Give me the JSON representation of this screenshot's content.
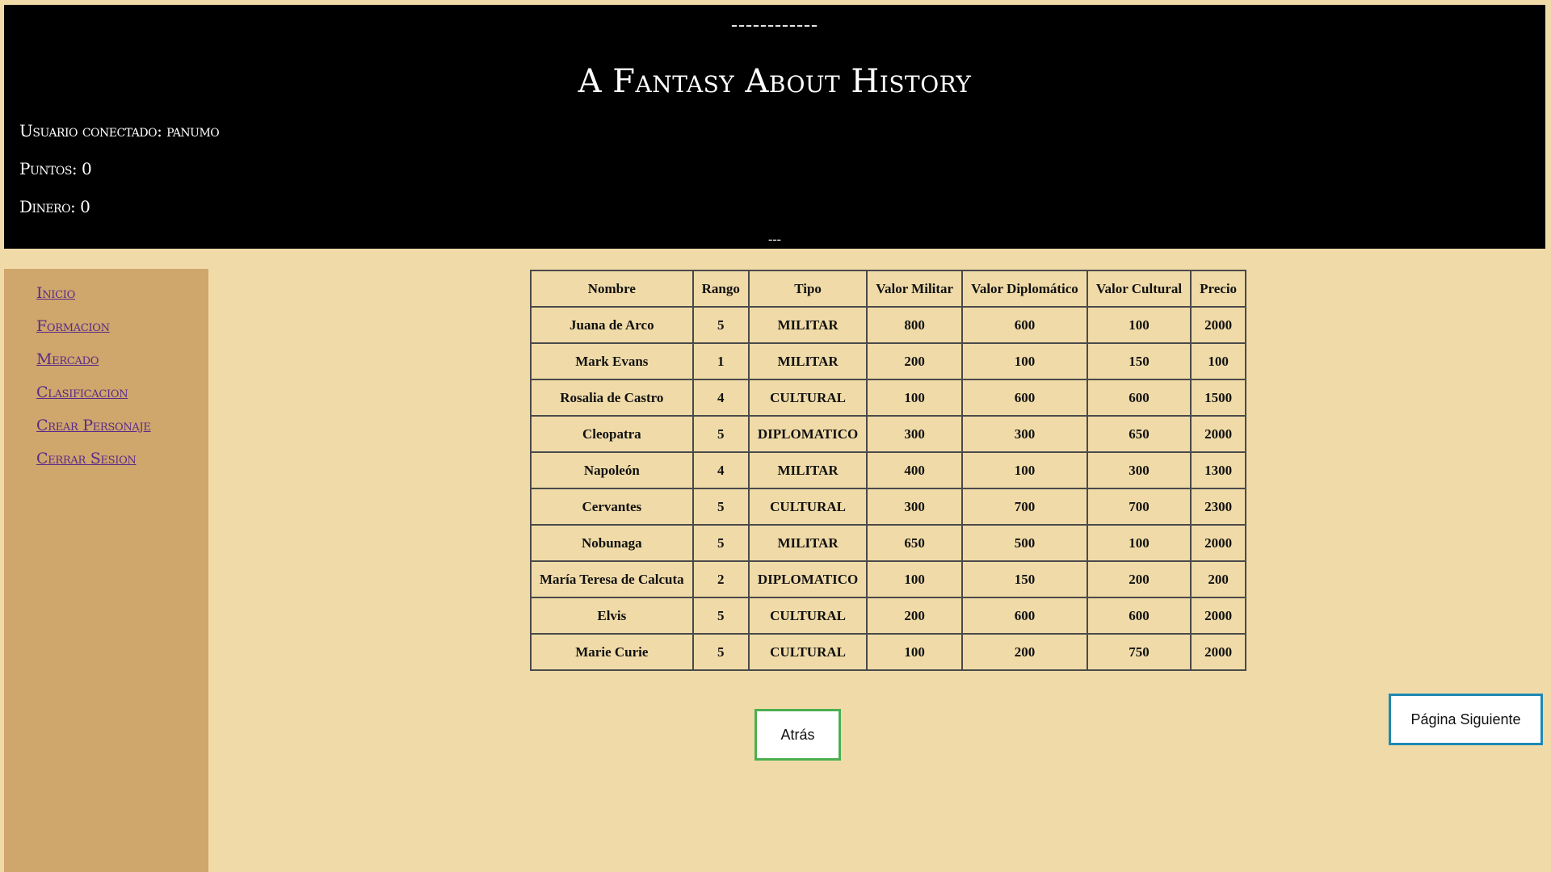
{
  "header": {
    "dashes": "------------",
    "title": "A Fantasy About History",
    "user_line": "Usuario conectado: panumo",
    "points_line": "Puntos: 0",
    "money_line": "Dinero: 0",
    "bottom_marker": "---"
  },
  "sidebar": {
    "items": [
      {
        "label": "Inicio"
      },
      {
        "label": "Formacion"
      },
      {
        "label": "Mercado"
      },
      {
        "label": "Clasificacion"
      },
      {
        "label": "Crear Personaje"
      },
      {
        "label": "Cerrar Sesion"
      }
    ]
  },
  "table": {
    "headers": [
      "Nombre",
      "Rango",
      "Tipo",
      "Valor Militar",
      "Valor Diplomático",
      "Valor Cultural",
      "Precio"
    ],
    "rows": [
      [
        "Juana de Arco",
        "5",
        "MILITAR",
        "800",
        "600",
        "100",
        "2000"
      ],
      [
        "Mark Evans",
        "1",
        "MILITAR",
        "200",
        "100",
        "150",
        "100"
      ],
      [
        "Rosalia de Castro",
        "4",
        "CULTURAL",
        "100",
        "600",
        "600",
        "1500"
      ],
      [
        "Cleopatra",
        "5",
        "DIPLOMATICO",
        "300",
        "300",
        "650",
        "2000"
      ],
      [
        "Napoleón",
        "4",
        "MILITAR",
        "400",
        "100",
        "300",
        "1300"
      ],
      [
        "Cervantes",
        "5",
        "CULTURAL",
        "300",
        "700",
        "700",
        "2300"
      ],
      [
        "Nobunaga",
        "5",
        "MILITAR",
        "650",
        "500",
        "100",
        "2000"
      ],
      [
        "María Teresa de Calcuta",
        "2",
        "DIPLOMATICO",
        "100",
        "150",
        "200",
        "200"
      ],
      [
        "Elvis",
        "5",
        "CULTURAL",
        "200",
        "600",
        "600",
        "2000"
      ],
      [
        "Marie Curie",
        "5",
        "CULTURAL",
        "100",
        "200",
        "750",
        "2000"
      ]
    ]
  },
  "buttons": {
    "back_label": "Atrás",
    "next_label": "Página Siguiente"
  },
  "colors": {
    "page_background": "#f0dba8",
    "header_background": "#000000",
    "sidebar_background": "#cfa66b",
    "link_color": "#5a2a88",
    "back_border": "#4caf50",
    "next_border": "#1e88b4"
  }
}
